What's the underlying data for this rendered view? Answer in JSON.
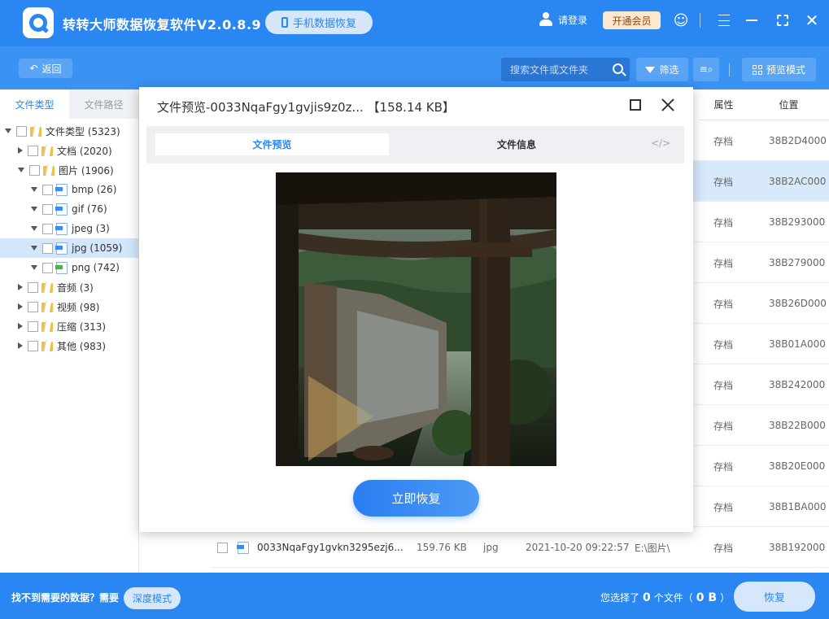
{
  "app": {
    "title": "转转大师数据恢复软件V2.0.8.9",
    "mobile_recovery_label": "手机数据恢复",
    "login_label": "请登录",
    "vip_label": "开通会员"
  },
  "toolbar": {
    "back_label": "返回",
    "search_placeholder": "搜索文件或文件夹",
    "filter_label": "筛选",
    "preview_mode_label": "预览模式"
  },
  "sidebar": {
    "tabs": [
      {
        "label": "文件类型",
        "active": true
      },
      {
        "label": "文件路径",
        "active": false
      }
    ],
    "tree": [
      {
        "label": "文件类型 (5323)",
        "level": 0,
        "expanded": true,
        "icon": "folder-icon"
      },
      {
        "label": "文档 (2020)",
        "level": 1,
        "expanded": false,
        "icon": "folder-icon"
      },
      {
        "label": "图片 (1906)",
        "level": 1,
        "expanded": true,
        "icon": "folder-icon"
      },
      {
        "label": "bmp (26)",
        "level": 2,
        "expanded": true,
        "icon": "image-file-icon"
      },
      {
        "label": "gif (76)",
        "level": 2,
        "expanded": true,
        "icon": "image-file-icon"
      },
      {
        "label": "jpeg (3)",
        "level": 2,
        "expanded": true,
        "icon": "image-file-icon"
      },
      {
        "label": "jpg (1059)",
        "level": 2,
        "expanded": true,
        "icon": "image-file-icon",
        "selected": true
      },
      {
        "label": "png (742)",
        "level": 2,
        "expanded": true,
        "icon": "png-file-icon"
      },
      {
        "label": "音频 (3)",
        "level": 1,
        "expanded": false,
        "icon": "folder-icon"
      },
      {
        "label": "视频 (98)",
        "level": 1,
        "expanded": false,
        "icon": "folder-icon"
      },
      {
        "label": "压缩 (313)",
        "level": 1,
        "expanded": false,
        "icon": "folder-icon"
      },
      {
        "label": "其他 (983)",
        "level": 1,
        "expanded": false,
        "icon": "folder-icon"
      }
    ]
  },
  "table": {
    "headers": {
      "attr": "属性",
      "location": "位置"
    },
    "rows": [
      {
        "attr": "存档",
        "location": "38B2D4000",
        "selected": false
      },
      {
        "attr": "存档",
        "location": "38B2AC000",
        "selected": true
      },
      {
        "attr": "存档",
        "location": "38B293000",
        "selected": false
      },
      {
        "attr": "存档",
        "location": "38B279000",
        "selected": false
      },
      {
        "attr": "存档",
        "location": "38B26D000",
        "selected": false
      },
      {
        "attr": "存档",
        "location": "38B01A000",
        "selected": false
      },
      {
        "attr": "存档",
        "location": "38B242000",
        "selected": false
      },
      {
        "attr": "存档",
        "location": "38B22B000",
        "selected": false
      },
      {
        "attr": "存档",
        "location": "38B20E000",
        "selected": false
      },
      {
        "attr": "存档",
        "location": "38B1BA000",
        "selected": false
      }
    ],
    "last_row": {
      "name": "0033NqaFgy1gvkn3295ezj6...",
      "size": "159.76 KB",
      "type": "jpg",
      "date": "2021-10-20 09:22:57",
      "path": "E:\\图片\\",
      "attr": "存档",
      "location": "38B192000"
    }
  },
  "modal": {
    "title": "文件预览-0033NqaFgy1gvjis9z0z... 【158.14 KB】",
    "tab_preview": "文件预览",
    "tab_info": "文件信息",
    "tab_code": "</>",
    "recover_now_label": "立即恢复"
  },
  "bottom": {
    "not_found_text": "找不到需要的数据？需要",
    "deep_mode_label": "深度模式",
    "selected_prefix": "您选择了",
    "selected_count": "0",
    "selected_mid": "个文件（",
    "selected_size": "0 B",
    "selected_suffix": "）",
    "recover_label": "恢复"
  },
  "colors": {
    "primary": "#2a86f0",
    "toolbar": "#3a92f3",
    "selected_row": "#d9e9fc",
    "vip_bg": "#fde7cf"
  }
}
